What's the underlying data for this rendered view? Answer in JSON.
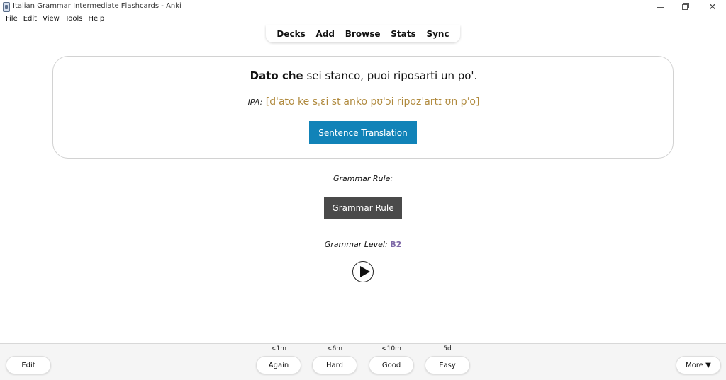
{
  "window": {
    "title": "Italian Grammar Intermediate Flashcards - Anki",
    "minimize": "—",
    "maximize": "▢",
    "close": "✕"
  },
  "menu": {
    "items": [
      {
        "label": "File"
      },
      {
        "label": "Edit"
      },
      {
        "label": "View"
      },
      {
        "label": "Tools"
      },
      {
        "label": "Help"
      }
    ]
  },
  "toolbar": {
    "decks": "Decks",
    "add": "Add",
    "browse": "Browse",
    "stats": "Stats",
    "sync": "Sync"
  },
  "card": {
    "sentence_bold": "Dato che",
    "sentence_rest": " sei stanco, puoi riposarti un po'.",
    "ipa_label": "IPA:",
    "ipa_value": " [dˈato ke sˌɛi stˈanko pʊˈɔi ripozˈartɪ ʊn pˈo]",
    "translation_button": "Sentence Translation",
    "grammar_label": "Grammar Rule:",
    "grammar_button": "Grammar Rule",
    "level_label": "Grammar Level: ",
    "level_value": "B2",
    "colors": {
      "ipa": "#b08a3e",
      "translation_button": "#1183b8",
      "grammar_button": "#4a4a4a",
      "level": "#7d67a7"
    }
  },
  "bottom": {
    "edit": "Edit",
    "more": "More ▼",
    "ease_buttons": [
      {
        "label": "Again",
        "time": "<1m"
      },
      {
        "label": "Hard",
        "time": "<6m"
      },
      {
        "label": "Good",
        "time": "<10m"
      },
      {
        "label": "Easy",
        "time": "5d"
      }
    ]
  }
}
